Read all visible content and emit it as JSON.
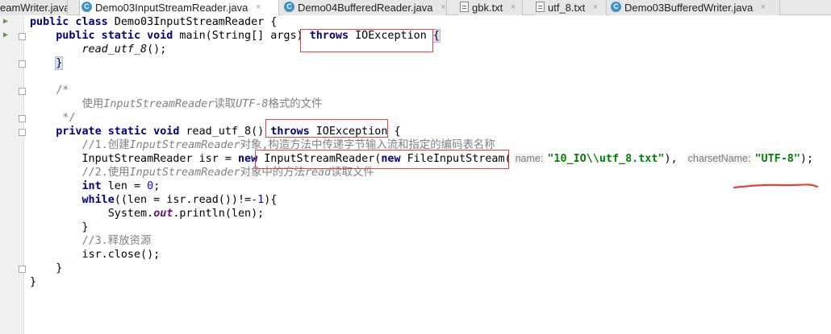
{
  "tabs": [
    {
      "label": "eamWriter.java",
      "icon": "java-class-icon",
      "active": false
    },
    {
      "label": "Demo03InputStreamReader.java",
      "icon": "java-class-icon",
      "active": true
    },
    {
      "label": "Demo04BufferedReader.java",
      "icon": "java-class-icon",
      "active": false
    },
    {
      "label": "gbk.txt",
      "icon": "text-file-icon",
      "active": false
    },
    {
      "label": "utf_8.txt",
      "icon": "text-file-icon",
      "active": false
    },
    {
      "label": "Demo03BufferedWriter.java",
      "icon": "java-class-icon",
      "active": false
    }
  ],
  "tab_close_glyph": "×",
  "code": {
    "l1_kw": "public class",
    "l1_name": " Demo03InputStreamReader {",
    "l2_kw1": "public static void",
    "l2_rest": " main(String[] args) ",
    "l2_kw2": "throws",
    "l2_exc": " IOException ",
    "l2_brace": "{",
    "l3_call": "read_utf_8",
    "l3_rest": "();",
    "l4_brace": "}",
    "l6_open": "/*",
    "l7_a": "使用",
    "l7_b": "InputStreamReader",
    "l7_c": "读取",
    "l7_d": "UTF-8",
    "l7_e": "格式的文件",
    "l8_close": " */",
    "l9_kw1": "private static void",
    "l9_rest": " read_utf_8() ",
    "l9_kw2": "throws",
    "l9_exc": " IOException {",
    "l10_a": "//1.创建",
    "l10_b": "InputStreamReader",
    "l10_c": "对象,构造方法中传递字节输入流和指定的编码表名称",
    "l11_a": "InputStreamReader isr = ",
    "l11_new1": "new",
    "l11_b": " InputStreamReader(",
    "l11_new2": "new",
    "l11_c": " FileInputStream(",
    "l11_hint1": "name:",
    "l11_str1": "\"10_IO\\\\utf_8.txt\"",
    "l11_d": "), ",
    "l11_hint2": "charsetName:",
    "l11_str2": "\"UTF-8\"",
    "l11_e": ");",
    "l12_a": "//2.使用",
    "l12_b": "InputStreamReader",
    "l12_c": "对象中的方法",
    "l12_d": "read",
    "l12_e": "读取文件",
    "l13_kw": "int",
    "l13_a": " len = ",
    "l13_num": "0",
    "l13_b": ";",
    "l14_kw": "while",
    "l14_a": "((len = isr.read())!=",
    "l14_num": "-1",
    "l14_b": "){",
    "l15_a": "System.",
    "l15_out": "out",
    "l15_b": ".println(len);",
    "l16": "}",
    "l17": "//3.释放资源",
    "l18": "isr.close();",
    "l19": "}",
    "l20": "}"
  },
  "colors": {
    "keyword": "#000080",
    "string": "#008000",
    "comment": "#808080",
    "number": "#0000ff",
    "annotation_red": "#e04040"
  }
}
